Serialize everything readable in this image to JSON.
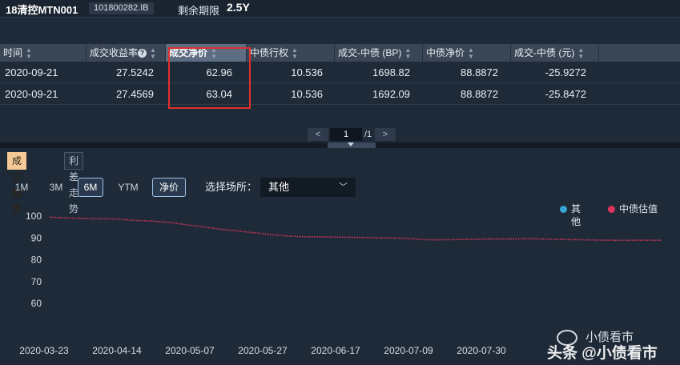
{
  "header": {
    "bond_name": "18清控MTN001",
    "bond_code": "101800282.IB",
    "remain_label": "剩余期限",
    "remain_value": "2.5Y"
  },
  "table": {
    "columns": [
      "时间",
      "成交收益率",
      "成交净价",
      "中债行权",
      "成交-中债 (BP)",
      "中债净价",
      "成交-中债 (元)"
    ],
    "rows": [
      [
        "2020-09-21",
        "27.5242",
        "62.96",
        "10.536",
        "1698.82",
        "88.8872",
        "-25.9272"
      ],
      [
        "2020-09-21",
        "27.4569",
        "63.04",
        "10.536",
        "1692.09",
        "88.8872",
        "-25.8472"
      ]
    ]
  },
  "pager": {
    "prev": "<",
    "current": "1",
    "total": "/1",
    "next": ">"
  },
  "tabs": [
    "成交趋势",
    "利差走势"
  ],
  "ranges": [
    "1M",
    "3M",
    "6M",
    "YTM",
    "净价"
  ],
  "venue": {
    "label": "选择场所：",
    "value": "其他"
  },
  "colors": {
    "accent": "#f4c996",
    "series_other": "#3aa6d8",
    "series_cbv": "#e0355f",
    "highlight": "#e0302b"
  },
  "chart_data": {
    "type": "line",
    "ylim": [
      60,
      100
    ],
    "yticks": [
      100,
      90,
      80,
      70,
      60
    ],
    "xlabels": [
      "2020-03-23",
      "2020-04-14",
      "2020-05-07",
      "2020-05-27",
      "2020-06-17",
      "2020-07-09",
      "2020-07-30"
    ],
    "legend": [
      "其他",
      "中债估值"
    ],
    "series": [
      {
        "name": "中债估值",
        "values": [
          99.5,
          99.3,
          99.1,
          98.9,
          98.8,
          98.7,
          98.4,
          98.0,
          97.8,
          97.4,
          96.8,
          96.0,
          95.3,
          94.5,
          93.8,
          93.2,
          92.6,
          92.0,
          91.4,
          90.9,
          90.6,
          90.5,
          90.5,
          90.4,
          90.3,
          90.2,
          90.1,
          90.0,
          89.9,
          89.6,
          89.2,
          89.1,
          89.2,
          89.3,
          89.4,
          89.5,
          89.5,
          89.5,
          89.6,
          89.6,
          89.4,
          89.3,
          89.2,
          89.1,
          89.0,
          88.9,
          88.9,
          88.9,
          88.9,
          88.9
        ]
      }
    ]
  },
  "watermark": {
    "top": "小债看市",
    "bottom": "头条 @小债看市"
  }
}
